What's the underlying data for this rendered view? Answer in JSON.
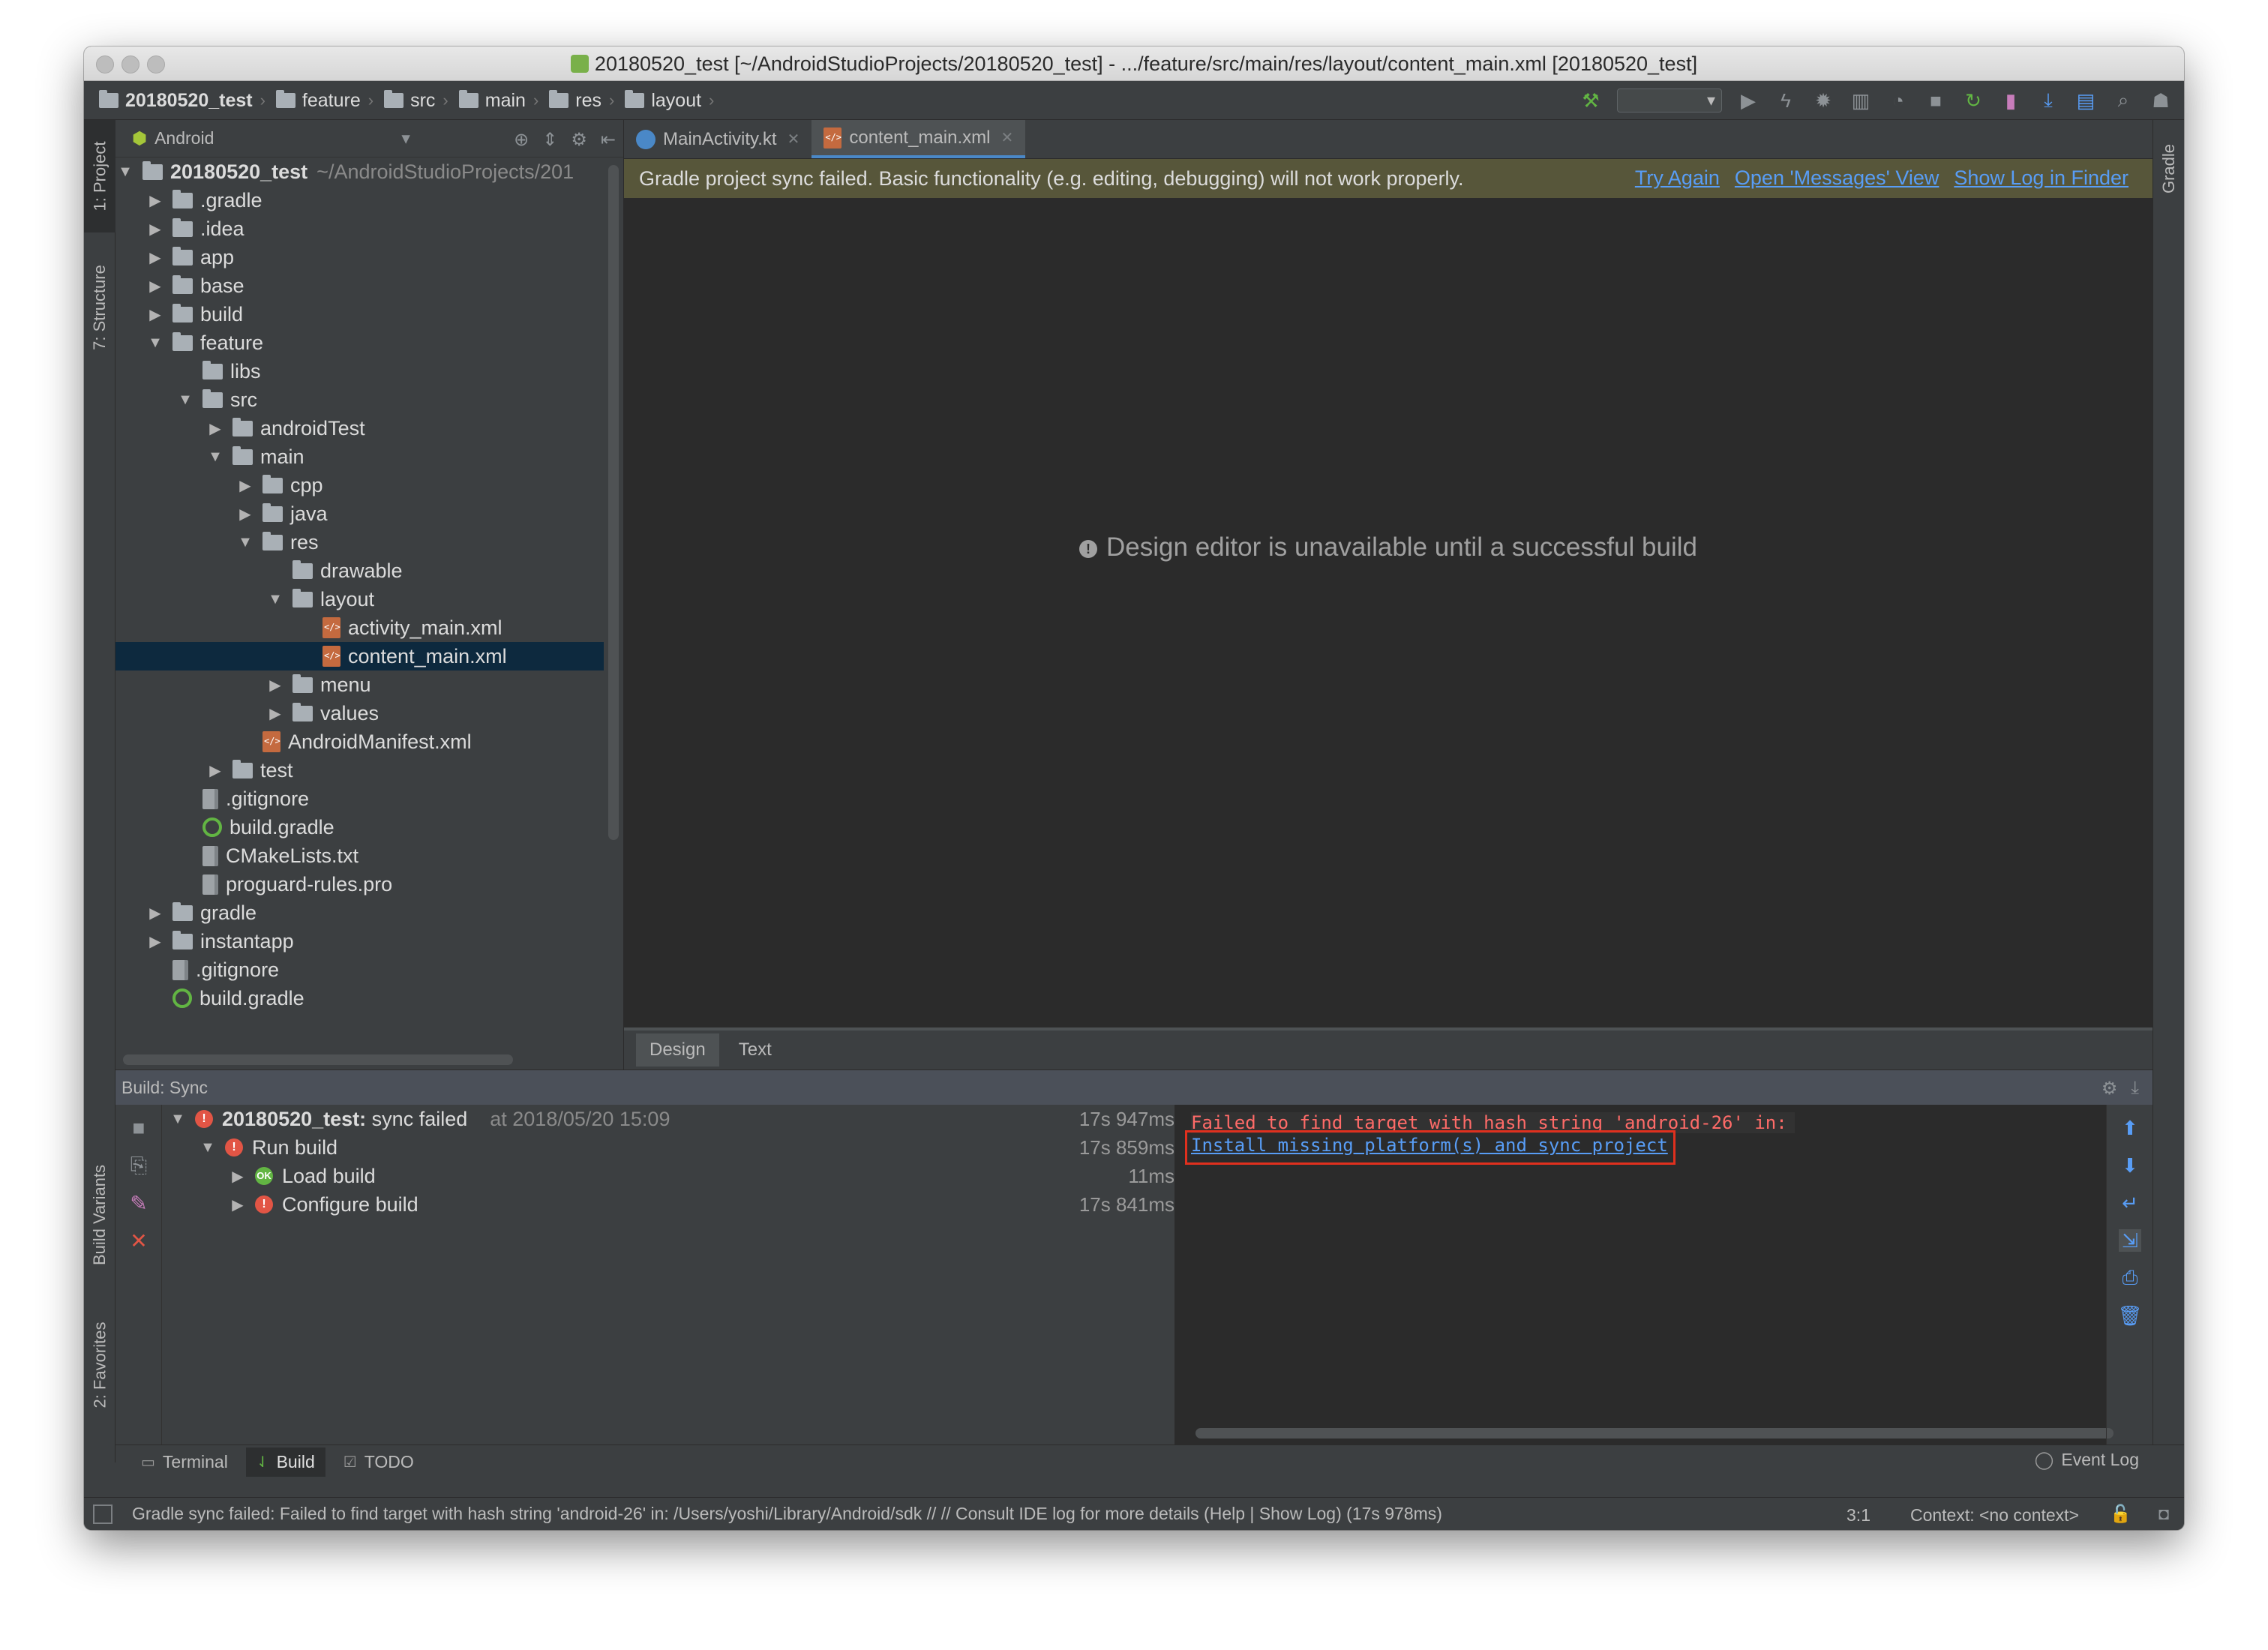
{
  "window": {
    "title": "20180520_test [~/AndroidStudioProjects/20180520_test] - .../feature/src/main/res/layout/content_main.xml [20180520_test]"
  },
  "breadcrumbs": [
    "20180520_test",
    "feature",
    "src",
    "main",
    "res",
    "layout"
  ],
  "left_strip": {
    "project": "1: Project",
    "structure": "7: Structure",
    "build_variants": "Build Variants",
    "favorites": "2: Favorites"
  },
  "right_strip": {
    "gradle": "Gradle"
  },
  "project_panel": {
    "view_mode": "Android",
    "root": {
      "name": "20180520_test",
      "path": "~/AndroidStudioProjects/201"
    },
    "items": [
      {
        "name": ".gradle",
        "type": "folder",
        "depth": 1,
        "state": "collapsed"
      },
      {
        "name": ".idea",
        "type": "folder",
        "depth": 1,
        "state": "collapsed"
      },
      {
        "name": "app",
        "type": "folder",
        "depth": 1,
        "state": "collapsed"
      },
      {
        "name": "base",
        "type": "folder",
        "depth": 1,
        "state": "collapsed"
      },
      {
        "name": "build",
        "type": "folder",
        "depth": 1,
        "state": "collapsed"
      },
      {
        "name": "feature",
        "type": "folder",
        "depth": 1,
        "state": "expanded"
      },
      {
        "name": "libs",
        "type": "folder",
        "depth": 2,
        "state": "none"
      },
      {
        "name": "src",
        "type": "folder",
        "depth": 2,
        "state": "expanded"
      },
      {
        "name": "androidTest",
        "type": "folder",
        "depth": 3,
        "state": "collapsed"
      },
      {
        "name": "main",
        "type": "folder",
        "depth": 3,
        "state": "expanded"
      },
      {
        "name": "cpp",
        "type": "folder",
        "depth": 4,
        "state": "collapsed"
      },
      {
        "name": "java",
        "type": "folder",
        "depth": 4,
        "state": "collapsed"
      },
      {
        "name": "res",
        "type": "folder",
        "depth": 4,
        "state": "expanded"
      },
      {
        "name": "drawable",
        "type": "folder",
        "depth": 5,
        "state": "none"
      },
      {
        "name": "layout",
        "type": "folder",
        "depth": 5,
        "state": "expanded"
      },
      {
        "name": "activity_main.xml",
        "type": "xml",
        "depth": 6,
        "state": "none"
      },
      {
        "name": "content_main.xml",
        "type": "xml",
        "depth": 6,
        "state": "none",
        "selected": true
      },
      {
        "name": "menu",
        "type": "folder",
        "depth": 5,
        "state": "collapsed"
      },
      {
        "name": "values",
        "type": "folder",
        "depth": 5,
        "state": "collapsed"
      },
      {
        "name": "AndroidManifest.xml",
        "type": "xml",
        "depth": 4,
        "state": "none"
      },
      {
        "name": "test",
        "type": "folder",
        "depth": 3,
        "state": "collapsed"
      },
      {
        "name": ".gitignore",
        "type": "file",
        "depth": 2,
        "state": "none"
      },
      {
        "name": "build.gradle",
        "type": "gradle",
        "depth": 2,
        "state": "none"
      },
      {
        "name": "CMakeLists.txt",
        "type": "file",
        "depth": 2,
        "state": "none"
      },
      {
        "name": "proguard-rules.pro",
        "type": "file",
        "depth": 2,
        "state": "none"
      },
      {
        "name": "gradle",
        "type": "folder",
        "depth": 1,
        "state": "collapsed"
      },
      {
        "name": "instantapp",
        "type": "folder",
        "depth": 1,
        "state": "collapsed"
      },
      {
        "name": ".gitignore",
        "type": "file",
        "depth": 1,
        "state": "none"
      },
      {
        "name": "build.gradle",
        "type": "gradle",
        "depth": 1,
        "state": "none"
      }
    ]
  },
  "editor": {
    "tabs": [
      {
        "label": "MainActivity.kt",
        "active": false
      },
      {
        "label": "content_main.xml",
        "active": true
      }
    ],
    "notification": "Gradle project sync failed. Basic functionality (e.g. editing, debugging) will not work properly.",
    "notification_links": [
      "Try Again",
      "Open 'Messages' View",
      "Show Log in Finder"
    ],
    "placeholder": "Design editor is unavailable until a successful build",
    "bottom_tabs": [
      "Design",
      "Text"
    ]
  },
  "build_panel": {
    "title": "Build: Sync",
    "tree": {
      "root": {
        "name": "20180520_test:",
        "status": "sync failed",
        "time_label": "at 2018/05/20 15:09",
        "duration": "17s 947ms"
      },
      "run_build": {
        "name": "Run build",
        "duration": "17s 859ms"
      },
      "load_build": {
        "name": "Load build",
        "duration": "11ms"
      },
      "configure_build": {
        "name": "Configure build",
        "duration": "17s 841ms"
      }
    },
    "console": {
      "error_line": "Failed to find target with hash string 'android-26' in:",
      "link_line": "Install missing platform(s) and sync project"
    }
  },
  "bottom_tabs": {
    "terminal": "Terminal",
    "build": "Build",
    "todo": "TODO",
    "event_log": "Event Log"
  },
  "status_bar": {
    "message": "Gradle sync failed: Failed to find target with hash string 'android-26' in: /Users/yoshi/Library/Android/sdk // // Consult IDE log for more details (Help | Show Log) (17s 978ms)",
    "position": "3:1",
    "context": "Context: <no context>"
  },
  "colors": {
    "accent_link": "#589df6",
    "error": "#ff6b68",
    "selection": "#0d293e",
    "highlight_box": "#e0301e"
  }
}
